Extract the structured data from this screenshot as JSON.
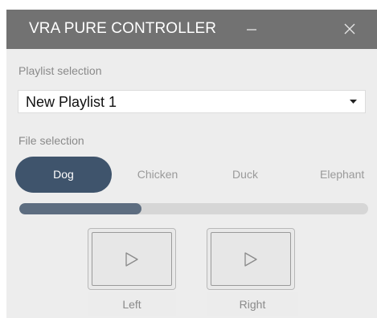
{
  "window": {
    "title": "VRA PURE CONTROLLER"
  },
  "icons": {
    "minimize": "minimize-icon",
    "close": "close-icon",
    "dropdown": "caret-down-icon",
    "play": "play-icon"
  },
  "playlist": {
    "label": "Playlist selection",
    "selected": "New Playlist 1"
  },
  "files": {
    "label": "File selection",
    "items": [
      "Dog",
      "Chicken",
      "Duck",
      "Elephant"
    ],
    "active_index": 0
  },
  "progress": {
    "value_percent": 35
  },
  "controls": {
    "left_label": "Left",
    "right_label": "Right"
  },
  "colors": {
    "titlebar": "#727272",
    "accent": "#3f546c",
    "progress_fill": "#5d6d80",
    "progress_track": "#d6d6d6",
    "background": "#ededed"
  }
}
